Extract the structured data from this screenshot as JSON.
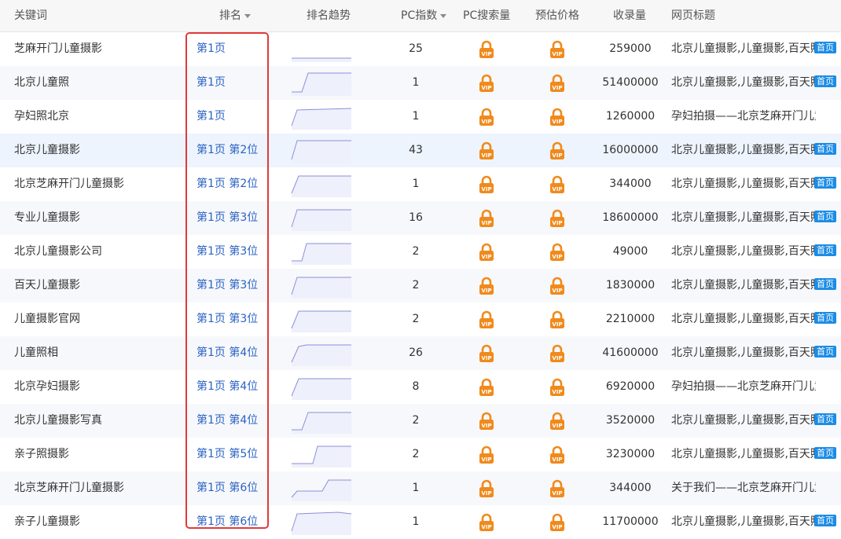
{
  "header": {
    "keyword": "关键词",
    "rank": "排名",
    "trend": "排名趋势",
    "pc_index": "PC指数",
    "pc_search": "PC搜索量",
    "price": "预估价格",
    "indexed": "收录量",
    "page_title": "网页标题"
  },
  "badge_label": "首页",
  "rows": [
    {
      "keyword": "芝麻开门儿童摄影",
      "rank": "第1页",
      "pc": "25",
      "indexed": "259000",
      "title": "北京儿童摄影,儿童摄影,百天照",
      "badge": true
    },
    {
      "keyword": "北京儿童照",
      "rank": "第1页",
      "pc": "1",
      "indexed": "51400000",
      "title": "北京儿童摄影,儿童摄影,百天照",
      "badge": true
    },
    {
      "keyword": "孕妇照北京",
      "rank": "第1页",
      "pc": "1",
      "indexed": "1260000",
      "title": "孕妇拍摄——北京芝麻开门儿童...",
      "badge": false
    },
    {
      "keyword": "北京儿童摄影",
      "rank": "第1页 第2位",
      "pc": "43",
      "indexed": "16000000",
      "title": "北京儿童摄影,儿童摄影,百天照",
      "badge": true
    },
    {
      "keyword": "北京芝麻开门儿童摄影",
      "rank": "第1页 第2位",
      "pc": "1",
      "indexed": "344000",
      "title": "北京儿童摄影,儿童摄影,百天照",
      "badge": true
    },
    {
      "keyword": "专业儿童摄影",
      "rank": "第1页 第3位",
      "pc": "16",
      "indexed": "18600000",
      "title": "北京儿童摄影,儿童摄影,百天照",
      "badge": true
    },
    {
      "keyword": "北京儿童摄影公司",
      "rank": "第1页 第3位",
      "pc": "2",
      "indexed": "49000",
      "title": "北京儿童摄影,儿童摄影,百天照",
      "badge": true
    },
    {
      "keyword": "百天儿童摄影",
      "rank": "第1页 第3位",
      "pc": "2",
      "indexed": "1830000",
      "title": "北京儿童摄影,儿童摄影,百天照",
      "badge": true
    },
    {
      "keyword": "儿童摄影官网",
      "rank": "第1页 第3位",
      "pc": "2",
      "indexed": "2210000",
      "title": "北京儿童摄影,儿童摄影,百天照",
      "badge": true
    },
    {
      "keyword": "儿童照相",
      "rank": "第1页 第4位",
      "pc": "26",
      "indexed": "41600000",
      "title": "北京儿童摄影,儿童摄影,百天照",
      "badge": true
    },
    {
      "keyword": "北京孕妇摄影",
      "rank": "第1页 第4位",
      "pc": "8",
      "indexed": "6920000",
      "title": "孕妇拍摄——北京芝麻开门儿童...",
      "badge": false
    },
    {
      "keyword": "北京儿童摄影写真",
      "rank": "第1页 第4位",
      "pc": "2",
      "indexed": "3520000",
      "title": "北京儿童摄影,儿童摄影,百天照",
      "badge": true
    },
    {
      "keyword": "亲子照摄影",
      "rank": "第1页 第5位",
      "pc": "2",
      "indexed": "3230000",
      "title": "北京儿童摄影,儿童摄影,百天照",
      "badge": true
    },
    {
      "keyword": "北京芝麻开门儿童摄影",
      "rank": "第1页 第6位",
      "pc": "1",
      "indexed": "344000",
      "title": "关于我们——北京芝麻开门儿童...",
      "badge": false
    },
    {
      "keyword": "亲子儿童摄影",
      "rank": "第1页 第6位",
      "pc": "1",
      "indexed": "11700000",
      "title": "北京儿童摄影,儿童摄影,百天照",
      "badge": true
    }
  ],
  "colors": {
    "link": "#2a62c4",
    "highlight_border": "#e03a3a",
    "badge": "#1b8ce6",
    "lock": "#f08a1c"
  },
  "icons": {
    "pc_search": "vip-lock-icon",
    "price": "vip-lock-icon",
    "sort": "sort-down-icon"
  }
}
